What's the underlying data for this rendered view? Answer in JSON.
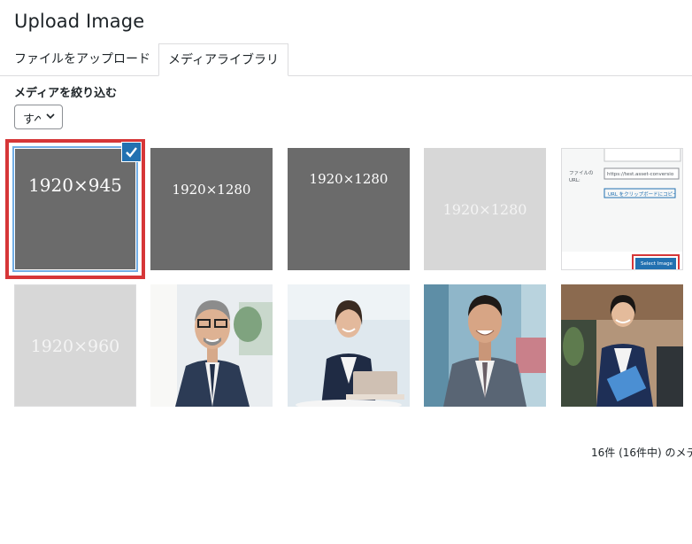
{
  "header": {
    "title": "Upload Image"
  },
  "tabs": [
    {
      "label": "ファイルをアップロード"
    },
    {
      "label": "メディアライブラリ"
    }
  ],
  "filter": {
    "label": "メディアを絞り込む",
    "value": "すべて"
  },
  "grid": {
    "items": [
      {
        "kind": "placeholder",
        "caption": "1920×945",
        "selected": true
      },
      {
        "kind": "placeholder",
        "caption": "1920×1280"
      },
      {
        "kind": "placeholder",
        "caption": "1920×1280"
      },
      {
        "kind": "placeholder",
        "caption": "1920×1280"
      },
      {
        "kind": "screenshot",
        "field_label": "ファイルの URL:",
        "url_value": "https://test.asset-conversio",
        "copy_button": "URL をクリップボードにコピー",
        "select_button": "Select Image"
      },
      {
        "kind": "placeholder",
        "caption": "1920×960"
      },
      {
        "kind": "photo",
        "subject": "businessman-portrait"
      },
      {
        "kind": "photo",
        "subject": "businesswoman-laptop"
      },
      {
        "kind": "photo",
        "subject": "businessman-city"
      },
      {
        "kind": "photo",
        "subject": "businesswoman-folder"
      }
    ]
  },
  "status": {
    "count_text": "16件 (16件中) のメデ"
  },
  "colors": {
    "selection_border": "#d63638",
    "check_bg": "#2271b1",
    "dark_placeholder": "#6b6b6b",
    "light_placeholder": "#d7d7d7"
  }
}
